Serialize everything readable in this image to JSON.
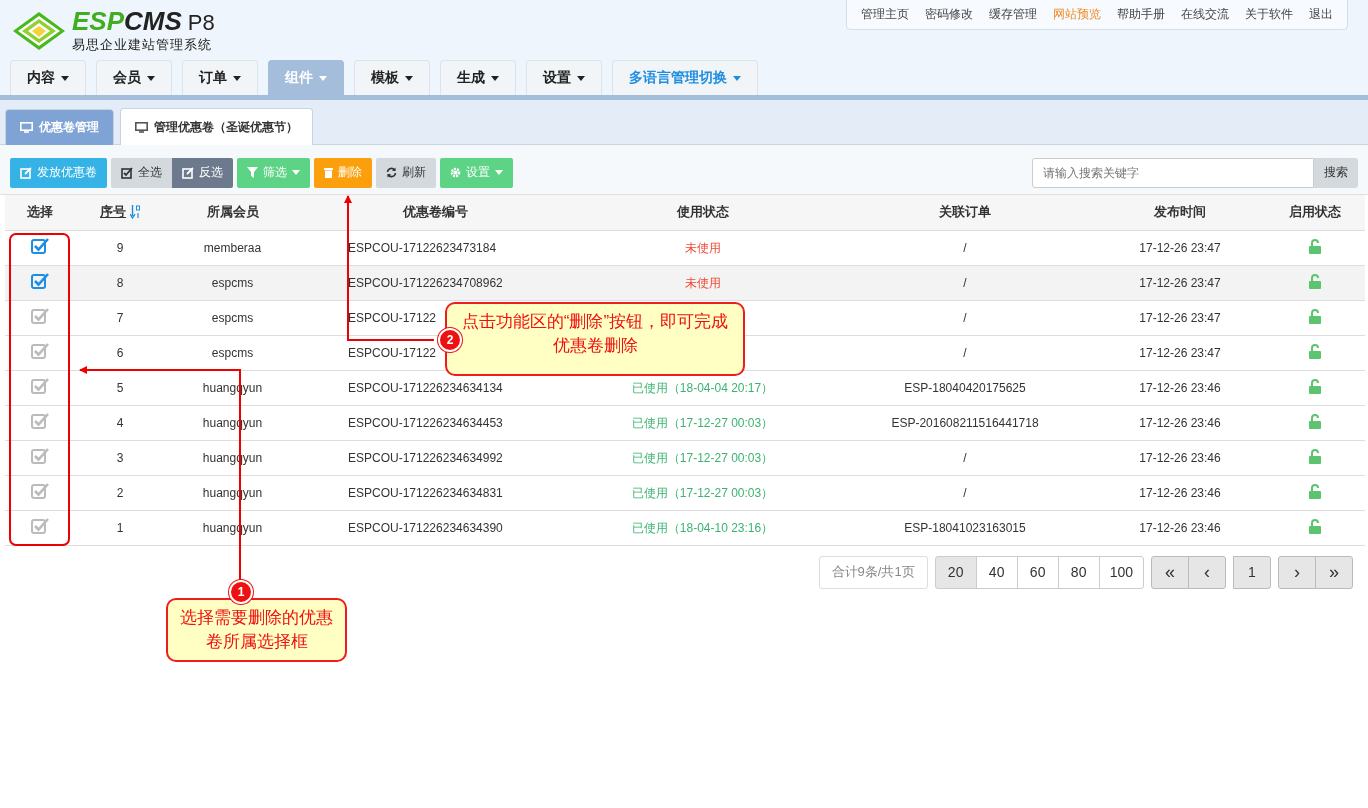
{
  "logo": {
    "brand_lead": "ESP",
    "brand_tail": "CMS",
    "version": "P8",
    "subtitle": "易思企业建站管理系统"
  },
  "top_links": [
    {
      "label": "管理主页",
      "highlighted": false
    },
    {
      "label": "密码修改",
      "highlighted": false
    },
    {
      "label": "缓存管理",
      "highlighted": false
    },
    {
      "label": "网站预览",
      "highlighted": true
    },
    {
      "label": "帮助手册",
      "highlighted": false
    },
    {
      "label": "在线交流",
      "highlighted": false
    },
    {
      "label": "关于软件",
      "highlighted": false
    },
    {
      "label": "退出",
      "highlighted": false
    }
  ],
  "nav": [
    {
      "label": "内容",
      "selected": false,
      "kind": "menu"
    },
    {
      "label": "会员",
      "selected": false,
      "kind": "menu"
    },
    {
      "label": "订单",
      "selected": false,
      "kind": "menu"
    },
    {
      "label": "组件",
      "selected": true,
      "kind": "menu"
    },
    {
      "label": "模板",
      "selected": false,
      "kind": "menu"
    },
    {
      "label": "生成",
      "selected": false,
      "kind": "menu"
    },
    {
      "label": "设置",
      "selected": false,
      "kind": "menu"
    },
    {
      "label": "多语言管理切换",
      "selected": false,
      "kind": "language"
    }
  ],
  "tabs": [
    {
      "label": "优惠卷管理",
      "selected": false
    },
    {
      "label": "管理优惠卷（圣诞优惠节）",
      "selected": true
    }
  ],
  "toolbar": [
    {
      "label": "发放优惠卷",
      "kind": "issue"
    },
    {
      "label": "全选",
      "kind": "select_all"
    },
    {
      "label": "反选",
      "kind": "invert"
    },
    {
      "label": "筛选",
      "kind": "filter"
    },
    {
      "label": "删除",
      "kind": "delete"
    },
    {
      "label": "刷新",
      "kind": "refresh"
    },
    {
      "label": "设置",
      "kind": "settings"
    }
  ],
  "search": {
    "placeholder": "请输入搜索关键字",
    "button": "搜索"
  },
  "table": {
    "columns": [
      "选择",
      "序号",
      "所属会员",
      "优惠卷编号",
      "使用状态",
      "关联订单",
      "发布时间",
      "启用状态"
    ],
    "rows": [
      {
        "checked": true,
        "highlighted": false,
        "no": "9",
        "member": "memberaa",
        "code": "ESPCOU-17122623473184",
        "status": {
          "text": "未使用",
          "color": "#f04a35"
        },
        "order": "/",
        "time": "17-12-26 23:47",
        "enabled": true
      },
      {
        "checked": true,
        "highlighted": true,
        "no": "8",
        "member": "espcms",
        "code": "ESPCOU-171226234708962",
        "status": {
          "text": "未使用",
          "color": "#f04a35"
        },
        "order": "/",
        "time": "17-12-26 23:47",
        "enabled": true
      },
      {
        "checked": false,
        "highlighted": false,
        "no": "7",
        "member": "espcms",
        "code": "ESPCOU-17122",
        "order": "/",
        "time": "17-12-26 23:47",
        "enabled": true
      },
      {
        "checked": false,
        "highlighted": false,
        "no": "6",
        "member": "espcms",
        "code": "ESPCOU-17122",
        "order": "/",
        "time": "17-12-26 23:47",
        "enabled": true
      },
      {
        "checked": false,
        "highlighted": false,
        "no": "5",
        "member": "huangqyun",
        "code": "ESPCOU-171226234634134",
        "status": {
          "text": "已使用（18-04-04 20:17）",
          "color": "#3cb371"
        },
        "order": "ESP-18040420175625",
        "time": "17-12-26 23:46",
        "enabled": true
      },
      {
        "checked": false,
        "highlighted": false,
        "no": "4",
        "member": "huangqyun",
        "code": "ESPCOU-171226234634453",
        "status": {
          "text": "已使用（17-12-27 00:03）",
          "color": "#3cb371"
        },
        "order": "ESP-201608211516441718",
        "time": "17-12-26 23:46",
        "enabled": true
      },
      {
        "checked": false,
        "highlighted": false,
        "no": "3",
        "member": "huangqyun",
        "code": "ESPCOU-171226234634992",
        "status": {
          "text": "已使用（17-12-27 00:03）",
          "color": "#3cb371"
        },
        "order": "/",
        "time": "17-12-26 23:46",
        "enabled": true
      },
      {
        "checked": false,
        "highlighted": false,
        "no": "2",
        "member": "huangqyun",
        "code": "ESPCOU-171226234634831",
        "status": {
          "text": "已使用（17-12-27 00:03）",
          "color": "#3cb371"
        },
        "order": "/",
        "time": "17-12-26 23:46",
        "enabled": true
      },
      {
        "checked": false,
        "highlighted": false,
        "no": "1",
        "member": "huangqyun",
        "code": "ESPCOU-171226234634390",
        "status": {
          "text": "已使用（18-04-10 23:16）",
          "color": "#3cb371"
        },
        "order": "ESP-18041023163015",
        "time": "17-12-26 23:46",
        "enabled": true
      }
    ]
  },
  "pagination": {
    "summary": "合计9条/共1页",
    "page_sizes": [
      {
        "label": "20",
        "selected": true
      },
      {
        "label": "40",
        "selected": false
      },
      {
        "label": "60",
        "selected": false
      },
      {
        "label": "80",
        "selected": false
      },
      {
        "label": "100",
        "selected": false
      }
    ],
    "first": "«",
    "prev": "‹",
    "pages": [
      {
        "label": "1",
        "selected": false
      }
    ],
    "next": "›",
    "last": "»"
  },
  "annotations": [
    {
      "number": "1",
      "text": "选择需要删除的优惠卷所属选择框"
    },
    {
      "number": "2",
      "text": "点击功能区的“删除”按钮，即可完成优惠卷删除"
    }
  ]
}
